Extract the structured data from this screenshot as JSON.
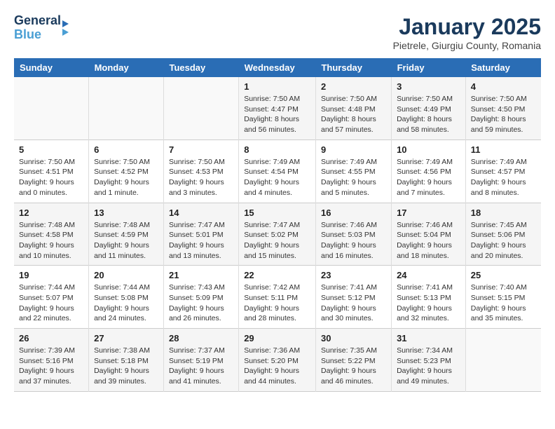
{
  "header": {
    "logo_line1": "General",
    "logo_line2": "Blue",
    "month": "January 2025",
    "location": "Pietrele, Giurgiu County, Romania"
  },
  "weekdays": [
    "Sunday",
    "Monday",
    "Tuesday",
    "Wednesday",
    "Thursday",
    "Friday",
    "Saturday"
  ],
  "weeks": [
    [
      {
        "day": "",
        "info": ""
      },
      {
        "day": "",
        "info": ""
      },
      {
        "day": "",
        "info": ""
      },
      {
        "day": "1",
        "info": "Sunrise: 7:50 AM\nSunset: 4:47 PM\nDaylight: 8 hours and 56 minutes."
      },
      {
        "day": "2",
        "info": "Sunrise: 7:50 AM\nSunset: 4:48 PM\nDaylight: 8 hours and 57 minutes."
      },
      {
        "day": "3",
        "info": "Sunrise: 7:50 AM\nSunset: 4:49 PM\nDaylight: 8 hours and 58 minutes."
      },
      {
        "day": "4",
        "info": "Sunrise: 7:50 AM\nSunset: 4:50 PM\nDaylight: 8 hours and 59 minutes."
      }
    ],
    [
      {
        "day": "5",
        "info": "Sunrise: 7:50 AM\nSunset: 4:51 PM\nDaylight: 9 hours and 0 minutes."
      },
      {
        "day": "6",
        "info": "Sunrise: 7:50 AM\nSunset: 4:52 PM\nDaylight: 9 hours and 1 minute."
      },
      {
        "day": "7",
        "info": "Sunrise: 7:50 AM\nSunset: 4:53 PM\nDaylight: 9 hours and 3 minutes."
      },
      {
        "day": "8",
        "info": "Sunrise: 7:49 AM\nSunset: 4:54 PM\nDaylight: 9 hours and 4 minutes."
      },
      {
        "day": "9",
        "info": "Sunrise: 7:49 AM\nSunset: 4:55 PM\nDaylight: 9 hours and 5 minutes."
      },
      {
        "day": "10",
        "info": "Sunrise: 7:49 AM\nSunset: 4:56 PM\nDaylight: 9 hours and 7 minutes."
      },
      {
        "day": "11",
        "info": "Sunrise: 7:49 AM\nSunset: 4:57 PM\nDaylight: 9 hours and 8 minutes."
      }
    ],
    [
      {
        "day": "12",
        "info": "Sunrise: 7:48 AM\nSunset: 4:58 PM\nDaylight: 9 hours and 10 minutes."
      },
      {
        "day": "13",
        "info": "Sunrise: 7:48 AM\nSunset: 4:59 PM\nDaylight: 9 hours and 11 minutes."
      },
      {
        "day": "14",
        "info": "Sunrise: 7:47 AM\nSunset: 5:01 PM\nDaylight: 9 hours and 13 minutes."
      },
      {
        "day": "15",
        "info": "Sunrise: 7:47 AM\nSunset: 5:02 PM\nDaylight: 9 hours and 15 minutes."
      },
      {
        "day": "16",
        "info": "Sunrise: 7:46 AM\nSunset: 5:03 PM\nDaylight: 9 hours and 16 minutes."
      },
      {
        "day": "17",
        "info": "Sunrise: 7:46 AM\nSunset: 5:04 PM\nDaylight: 9 hours and 18 minutes."
      },
      {
        "day": "18",
        "info": "Sunrise: 7:45 AM\nSunset: 5:06 PM\nDaylight: 9 hours and 20 minutes."
      }
    ],
    [
      {
        "day": "19",
        "info": "Sunrise: 7:44 AM\nSunset: 5:07 PM\nDaylight: 9 hours and 22 minutes."
      },
      {
        "day": "20",
        "info": "Sunrise: 7:44 AM\nSunset: 5:08 PM\nDaylight: 9 hours and 24 minutes."
      },
      {
        "day": "21",
        "info": "Sunrise: 7:43 AM\nSunset: 5:09 PM\nDaylight: 9 hours and 26 minutes."
      },
      {
        "day": "22",
        "info": "Sunrise: 7:42 AM\nSunset: 5:11 PM\nDaylight: 9 hours and 28 minutes."
      },
      {
        "day": "23",
        "info": "Sunrise: 7:41 AM\nSunset: 5:12 PM\nDaylight: 9 hours and 30 minutes."
      },
      {
        "day": "24",
        "info": "Sunrise: 7:41 AM\nSunset: 5:13 PM\nDaylight: 9 hours and 32 minutes."
      },
      {
        "day": "25",
        "info": "Sunrise: 7:40 AM\nSunset: 5:15 PM\nDaylight: 9 hours and 35 minutes."
      }
    ],
    [
      {
        "day": "26",
        "info": "Sunrise: 7:39 AM\nSunset: 5:16 PM\nDaylight: 9 hours and 37 minutes."
      },
      {
        "day": "27",
        "info": "Sunrise: 7:38 AM\nSunset: 5:18 PM\nDaylight: 9 hours and 39 minutes."
      },
      {
        "day": "28",
        "info": "Sunrise: 7:37 AM\nSunset: 5:19 PM\nDaylight: 9 hours and 41 minutes."
      },
      {
        "day": "29",
        "info": "Sunrise: 7:36 AM\nSunset: 5:20 PM\nDaylight: 9 hours and 44 minutes."
      },
      {
        "day": "30",
        "info": "Sunrise: 7:35 AM\nSunset: 5:22 PM\nDaylight: 9 hours and 46 minutes."
      },
      {
        "day": "31",
        "info": "Sunrise: 7:34 AM\nSunset: 5:23 PM\nDaylight: 9 hours and 49 minutes."
      },
      {
        "day": "",
        "info": ""
      }
    ]
  ]
}
